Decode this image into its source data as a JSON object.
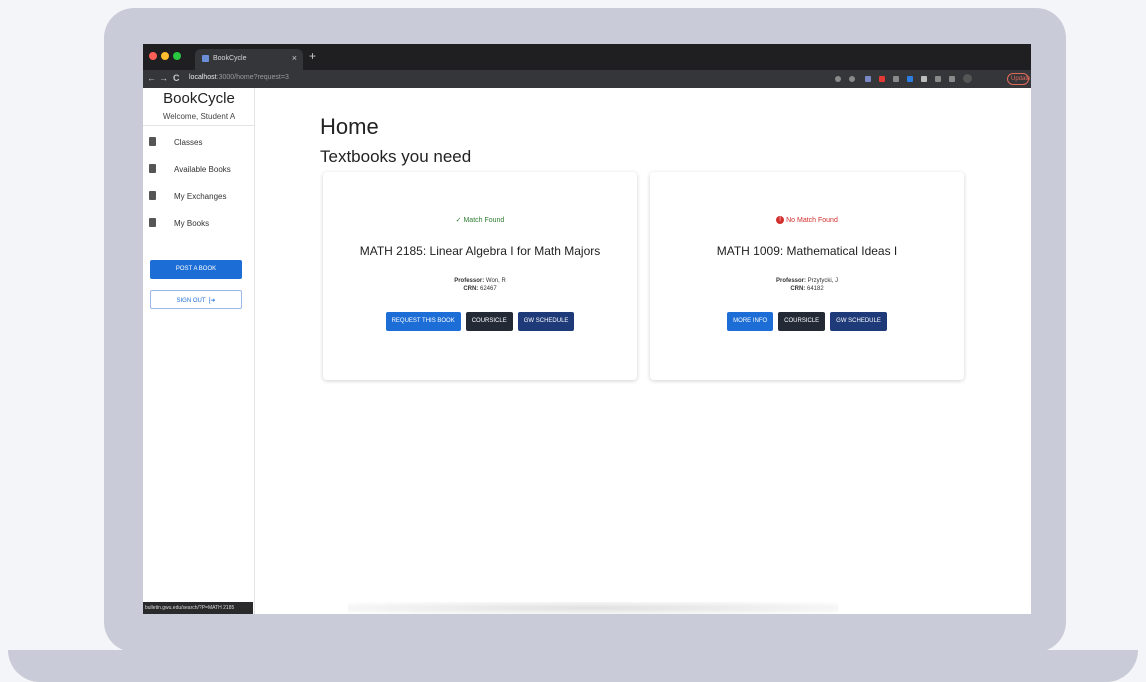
{
  "browser": {
    "tab_title": "BookCycle",
    "tab_close": "×",
    "new_tab": "+",
    "nav_back": "←",
    "nav_forward": "→",
    "nav_reload": "C",
    "url_host": "localhost",
    "url_path": ":3000/home?request=3",
    "update_label": "Update"
  },
  "sidebar": {
    "brand": "BookCycle",
    "welcome": "Welcome, Student A",
    "items": [
      {
        "label": "Classes"
      },
      {
        "label": "Available Books"
      },
      {
        "label": "My Exchanges"
      },
      {
        "label": "My Books"
      }
    ],
    "post_label": "POST A BOOK",
    "signout_label": "SIGN OUT"
  },
  "status_url": "bulletin.gwu.edu/search/?P=MATH 2185",
  "main": {
    "title": "Home",
    "section_title": "Textbooks you need",
    "cards": [
      {
        "status": "✓ Match Found",
        "status_color": "#2e7d32",
        "course": "MATH 2185: Linear Algebra I for Math Majors",
        "professor_label": "Professor:",
        "professor": "Won, R",
        "crn_label": "CRN:",
        "crn": "62467",
        "buttons": [
          "REQUEST THIS BOOK",
          "COURSICLE",
          "GW SCHEDULE"
        ]
      },
      {
        "status": "No Match Found",
        "status_color": "#d32f2f",
        "course": "MATH 1009: Mathematical Ideas I",
        "professor_label": "Professor:",
        "professor": "Przytycki, J",
        "crn_label": "CRN:",
        "crn": "64182",
        "buttons": [
          "MORE INFO",
          "COURSICLE",
          "GW SCHEDULE"
        ]
      }
    ]
  }
}
